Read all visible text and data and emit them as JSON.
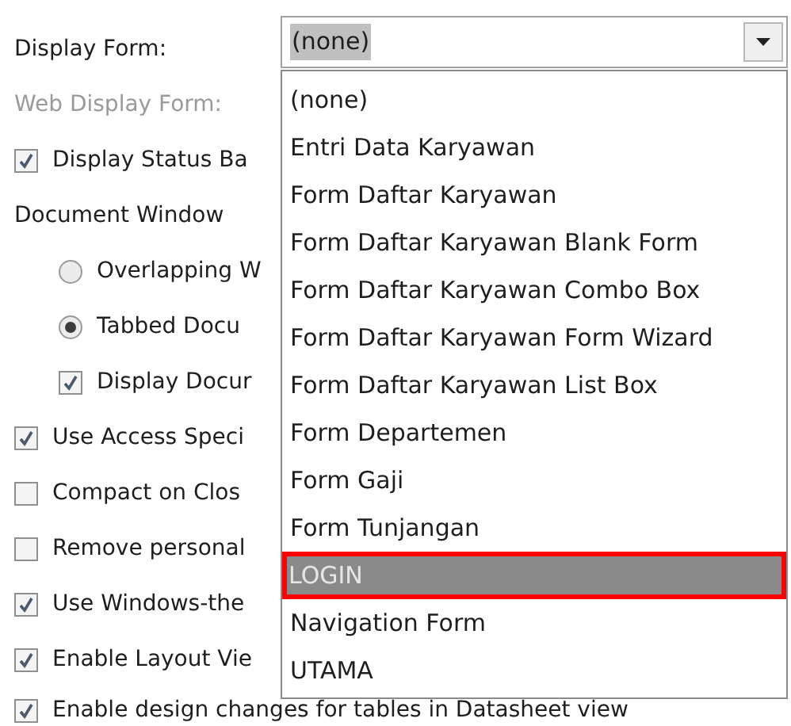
{
  "display_form": {
    "label": "Display Form:",
    "value": "(none)"
  },
  "web_display_form": {
    "label": "Web Display Form:",
    "disabled": true
  },
  "options": [
    {
      "kind": "checkbox",
      "label": "Display Status Ba",
      "checked": true
    },
    {
      "kind": "group",
      "label": "Document Window",
      "children": [
        {
          "kind": "radio",
          "label": "Overlapping W",
          "selected": false
        },
        {
          "kind": "radio",
          "label": "Tabbed Docu",
          "selected": true
        },
        {
          "kind": "checkbox",
          "label": "Display Docur",
          "checked": true
        }
      ]
    },
    {
      "kind": "checkbox",
      "label": "Use Access Speci",
      "checked": true
    },
    {
      "kind": "checkbox",
      "label": "Compact on Clos",
      "checked": false
    },
    {
      "kind": "checkbox",
      "label": "Remove personal",
      "checked": false
    },
    {
      "kind": "checkbox",
      "label": "Use Windows-the",
      "checked": true
    },
    {
      "kind": "checkbox",
      "label": "Enable Layout Vie",
      "checked": true
    },
    {
      "kind": "checkbox",
      "label": "Enable design changes for tables in Datasheet view",
      "checked": true
    }
  ],
  "dropdown_list": [
    {
      "label": "(none)",
      "selected": false
    },
    {
      "label": "Entri Data Karyawan",
      "selected": false
    },
    {
      "label": "Form Daftar Karyawan",
      "selected": false
    },
    {
      "label": "Form Daftar Karyawan Blank Form",
      "selected": false
    },
    {
      "label": "Form Daftar Karyawan Combo Box",
      "selected": false
    },
    {
      "label": "Form Daftar Karyawan Form Wizard",
      "selected": false
    },
    {
      "label": "Form Daftar Karyawan List Box",
      "selected": false
    },
    {
      "label": "Form Departemen",
      "selected": false
    },
    {
      "label": "Form Gaji",
      "selected": false
    },
    {
      "label": "Form Tunjangan",
      "selected": false
    },
    {
      "label": "LOGIN",
      "selected": true
    },
    {
      "label": "Navigation Form",
      "selected": false
    },
    {
      "label": "UTAMA",
      "selected": false
    }
  ]
}
